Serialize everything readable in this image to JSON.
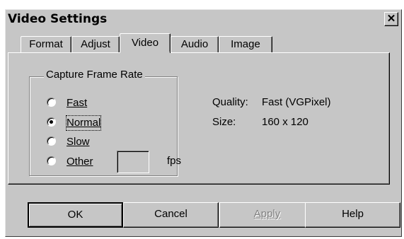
{
  "window": {
    "title": "Video Settings",
    "close_glyph": "✕"
  },
  "tabs": [
    {
      "label": "Format",
      "active": false
    },
    {
      "label": "Adjust",
      "active": false
    },
    {
      "label": "Video",
      "active": true
    },
    {
      "label": "Audio",
      "active": false
    },
    {
      "label": "Image",
      "active": false
    }
  ],
  "capture": {
    "group_label": "Capture Frame Rate",
    "options": [
      {
        "label": "Fast",
        "selected": false
      },
      {
        "label": "Normal",
        "selected": true
      },
      {
        "label": "Slow",
        "selected": false
      },
      {
        "label": "Other",
        "selected": false
      }
    ],
    "other_value": "",
    "fps_label": "fps"
  },
  "info": {
    "quality_label": "Quality:",
    "quality_value": "Fast (VGPixel)",
    "size_label": "Size:",
    "size_value": "160 x 120"
  },
  "buttons": {
    "ok": "OK",
    "cancel": "Cancel",
    "apply": "Apply",
    "help": "Help"
  },
  "colors": {
    "face": "#c6c6c6",
    "shadow": "#808080",
    "highlight": "#ffffff"
  }
}
